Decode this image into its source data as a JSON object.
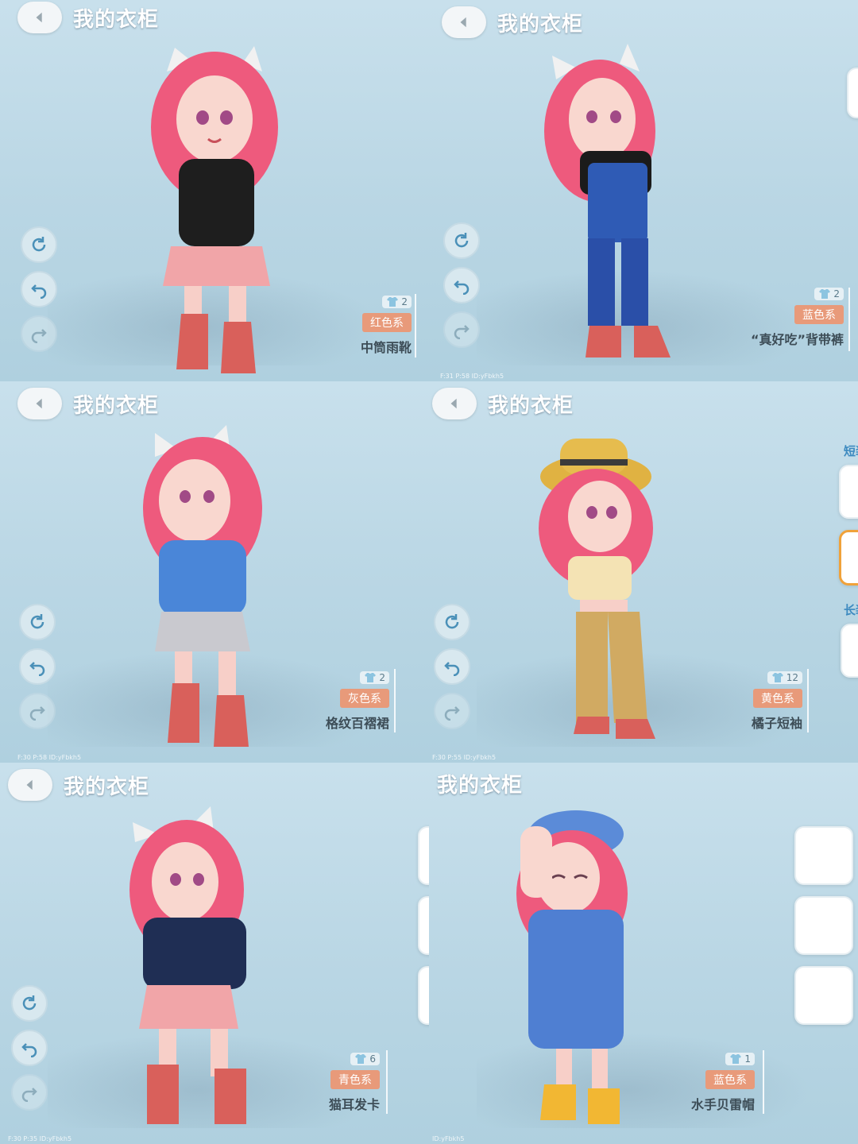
{
  "panels": [
    {
      "title": "我的衣柜",
      "likes": "2",
      "color_tag": "红色系",
      "item": "中筒雨靴",
      "debug": ""
    },
    {
      "title": "我的衣柜",
      "likes": "2",
      "color_tag": "蓝色系",
      "item": "“真好吃”背带裤",
      "debug": "F:31  P:58  ID:yFbkh5"
    },
    {
      "title": "我的衣柜",
      "likes": "2",
      "color_tag": "灰色系",
      "item": "格纹百褶裙",
      "debug": "F:30  P:58  ID:yFbkh5"
    },
    {
      "title": "我的衣柜",
      "likes": "12",
      "color_tag": "黄色系",
      "item": "橘子短袖",
      "debug": "F:30  P:55  ID:yFbkh5"
    },
    {
      "title": "我的衣柜",
      "likes": "6",
      "color_tag": "青色系",
      "item": "猫耳发卡",
      "debug": "F:30  P:35  ID:yFbkh5"
    },
    {
      "title": "我的衣柜",
      "likes": "1",
      "color_tag": "蓝色系",
      "item": "水手贝雷帽",
      "debug": "ID:yFbkh5"
    }
  ],
  "side_labels": {
    "short": "短装",
    "long": "长装"
  },
  "icons": {
    "back": "chevron-left-icon",
    "rotate": "rotate-icon",
    "undo": "undo-icon",
    "redo": "redo-icon",
    "likes": "clothes-icon"
  },
  "colors": {
    "tag": "#e89a7a",
    "title": "#ffffff",
    "bg": "#bcd9e6",
    "selected": "#f0a23a"
  }
}
